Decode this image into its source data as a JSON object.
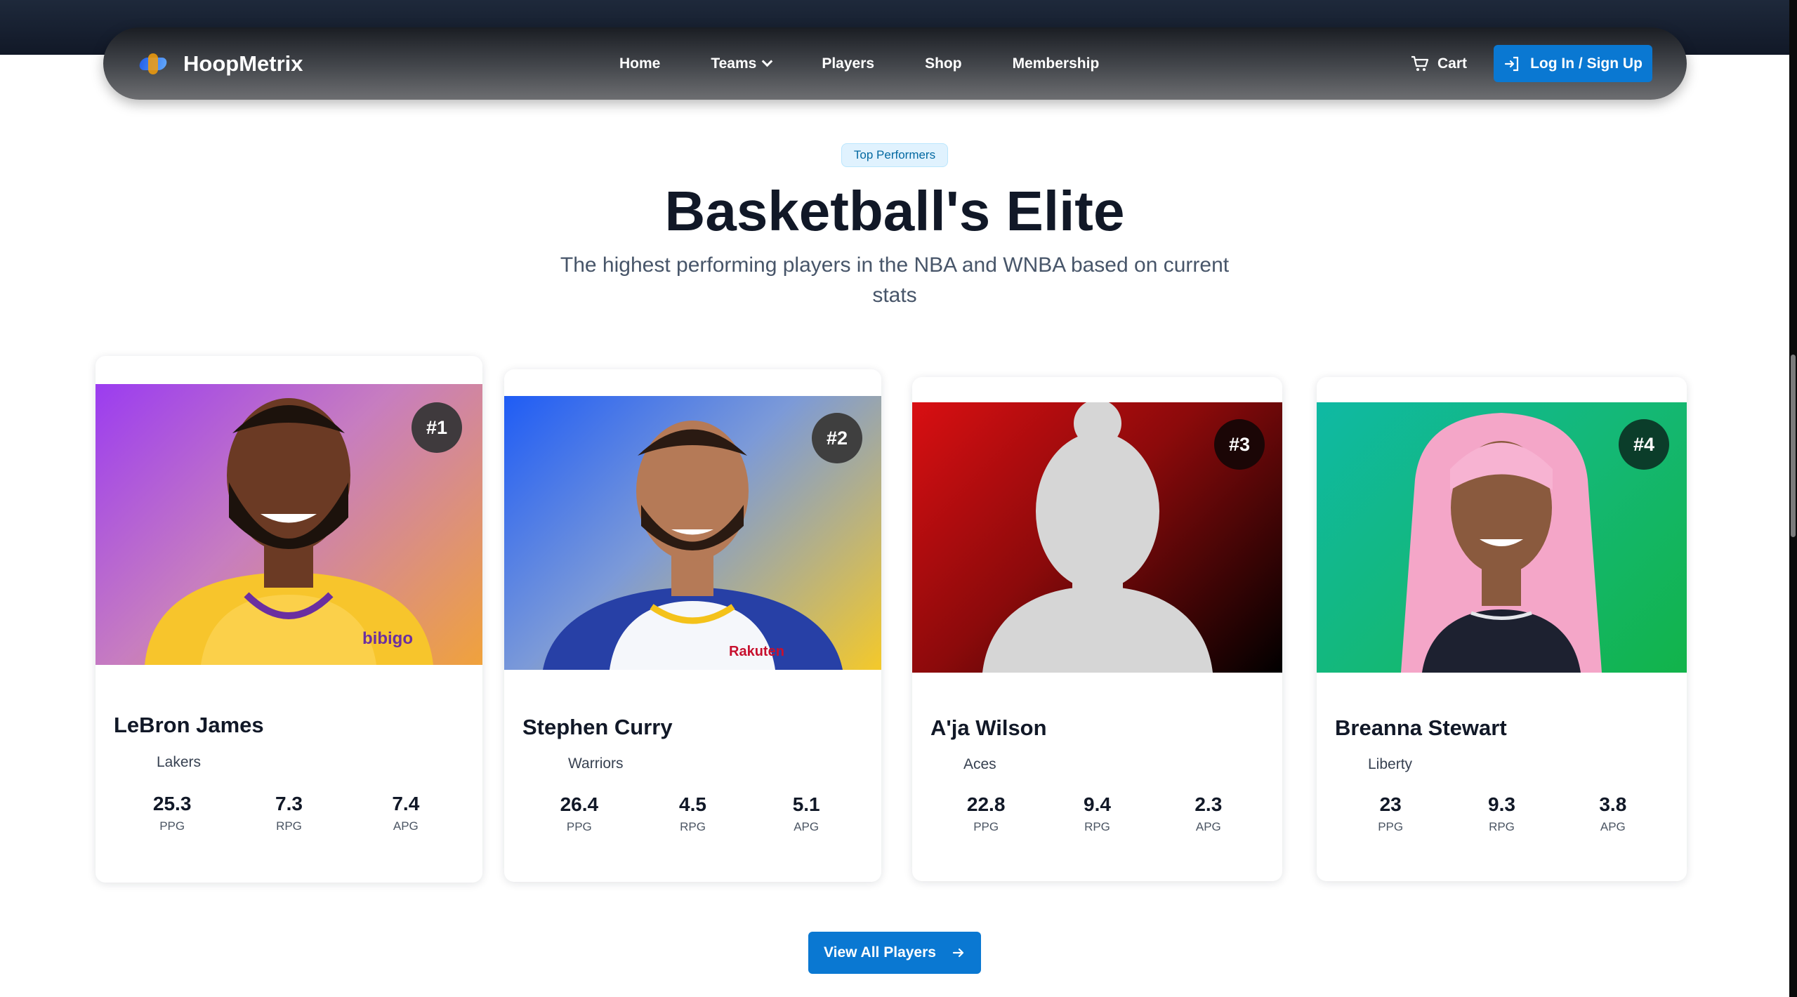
{
  "nav": {
    "brand": "HoopMetrix",
    "links": [
      "Home",
      "Teams",
      "Players",
      "Shop",
      "Membership"
    ],
    "cart_label": "Cart",
    "login_label": "Log In / Sign Up"
  },
  "hero": {
    "badge": "Top Performers",
    "title": "Basketball's Elite",
    "subtitle": "The highest performing players in the NBA and WNBA based on current stats"
  },
  "players": [
    {
      "rank": "#1",
      "name": "LeBron James",
      "team": "Lakers",
      "stats": [
        {
          "value": "25.3",
          "label": "PPG"
        },
        {
          "value": "7.3",
          "label": "RPG"
        },
        {
          "value": "7.4",
          "label": "APG"
        }
      ]
    },
    {
      "rank": "#2",
      "name": "Stephen Curry",
      "team": "Warriors",
      "stats": [
        {
          "value": "26.4",
          "label": "PPG"
        },
        {
          "value": "4.5",
          "label": "RPG"
        },
        {
          "value": "5.1",
          "label": "APG"
        }
      ]
    },
    {
      "rank": "#3",
      "name": "A'ja Wilson",
      "team": "Aces",
      "stats": [
        {
          "value": "22.8",
          "label": "PPG"
        },
        {
          "value": "9.4",
          "label": "RPG"
        },
        {
          "value": "2.3",
          "label": "APG"
        }
      ]
    },
    {
      "rank": "#4",
      "name": "Breanna Stewart",
      "team": "Liberty",
      "stats": [
        {
          "value": "23",
          "label": "PPG"
        },
        {
          "value": "9.3",
          "label": "RPG"
        },
        {
          "value": "3.8",
          "label": "APG"
        }
      ]
    }
  ],
  "cta": {
    "label": "View All Players"
  },
  "icons": {
    "logo": "hoopmetrix-logo-icon",
    "cart": "cart-icon",
    "login": "login-icon",
    "teams_dropdown": "chevron-down-icon",
    "cta_arrow": "arrow-right-icon"
  },
  "colors": {
    "primary": "#0a78d2",
    "nav_dark": "#1a1d23",
    "title": "#111827",
    "badge_bg": "#e0f2fe",
    "badge_text": "#0369a1"
  }
}
